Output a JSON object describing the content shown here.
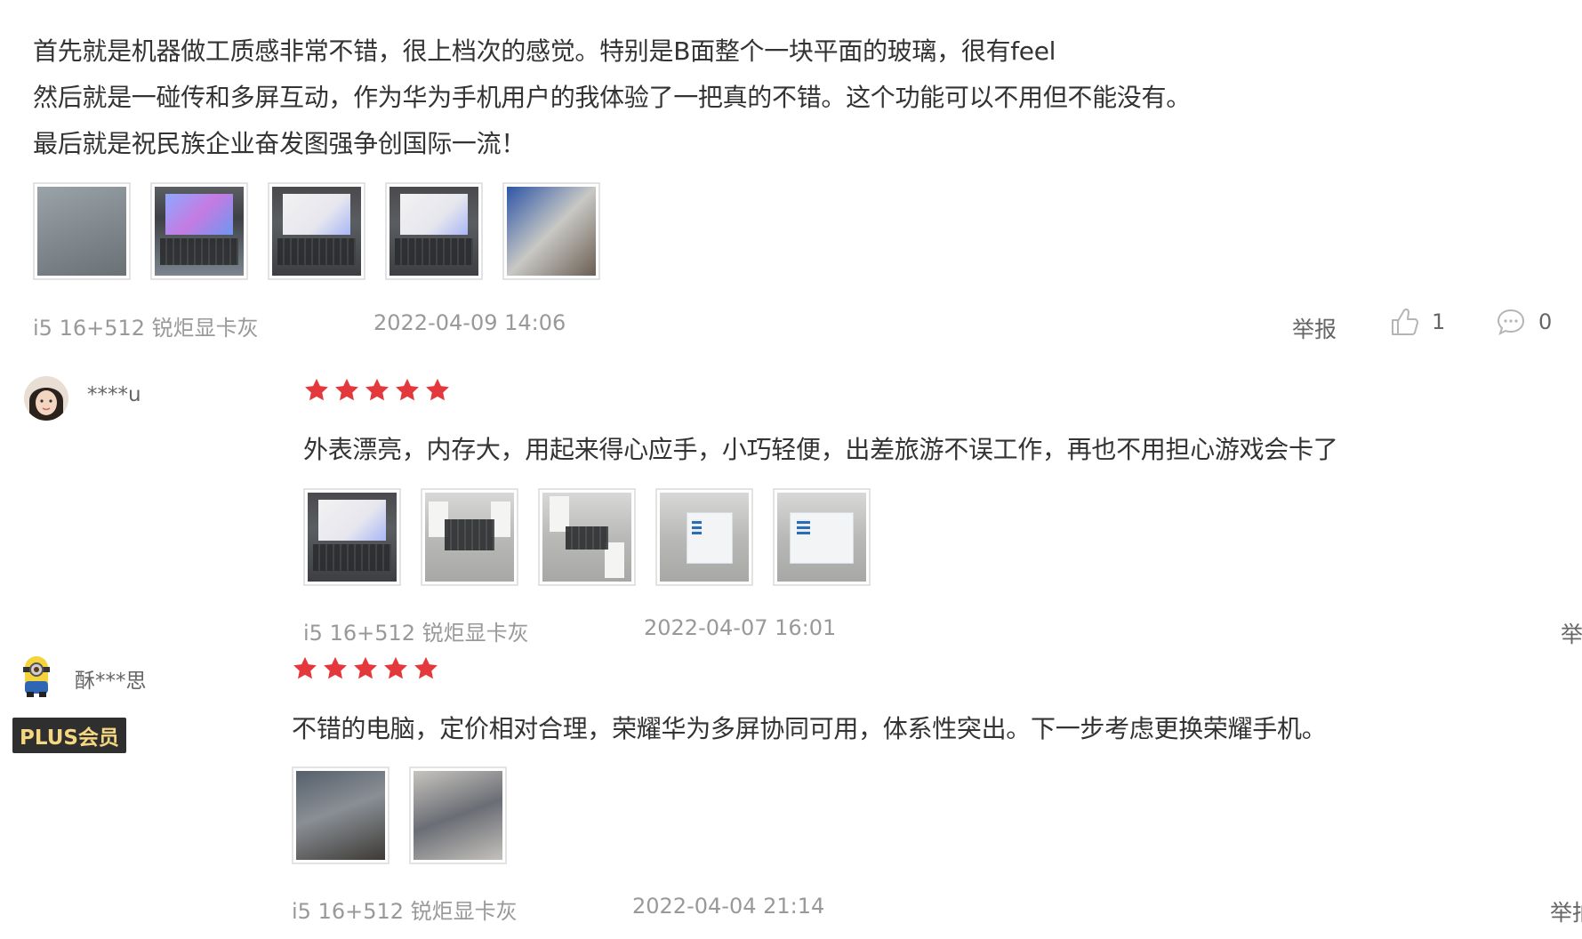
{
  "reviews": [
    {
      "text_lines": [
        "首先就是机器做工质感非常不错，很上档次的感觉。特别是B面整个一块平面的玻璃，很有feel",
        "然后就是一碰传和多屏互动，作为华为手机用户的我体验了一把真的不错。这个功能可以不用但不能没有。",
        "最后就是祝民族企业奋发图强争创国际一流！"
      ],
      "variant": "i5 16+512 锐炬显卡灰",
      "date": "2022-04-09 14:06",
      "report_label": "举报",
      "like_count": "1",
      "reply_count": "0",
      "image_count": 5
    },
    {
      "nickname": "****u",
      "rating": 5,
      "text": "外表漂亮，内存大，用起来得心应手，小巧轻便，出差旅游不误工作，再也不用担心游戏会卡了",
      "variant": "i5 16+512 锐炬显卡灰",
      "date": "2022-04-07 16:01",
      "report_label": "举",
      "image_count": 5
    },
    {
      "nickname": "酥***思",
      "badge": "PLUS会员",
      "rating": 5,
      "text": "不错的电脑，定价相对合理，荣耀华为多屏协同可用，体系性突出。下一步考虑更换荣耀手机。",
      "variant": "i5 16+512 锐炬显卡灰",
      "date": "2022-04-04 21:14",
      "report_label": "举拍",
      "image_count": 2
    }
  ],
  "colors": {
    "star": "#e4393c",
    "meta_text": "#999999",
    "body_text": "#333333",
    "plus_badge_bg": "#2f2f2f",
    "plus_badge_text": "#f4d780"
  },
  "icons": {
    "like": "thumbs-up-icon",
    "reply": "comment-bubble-icon",
    "star": "star-icon"
  }
}
